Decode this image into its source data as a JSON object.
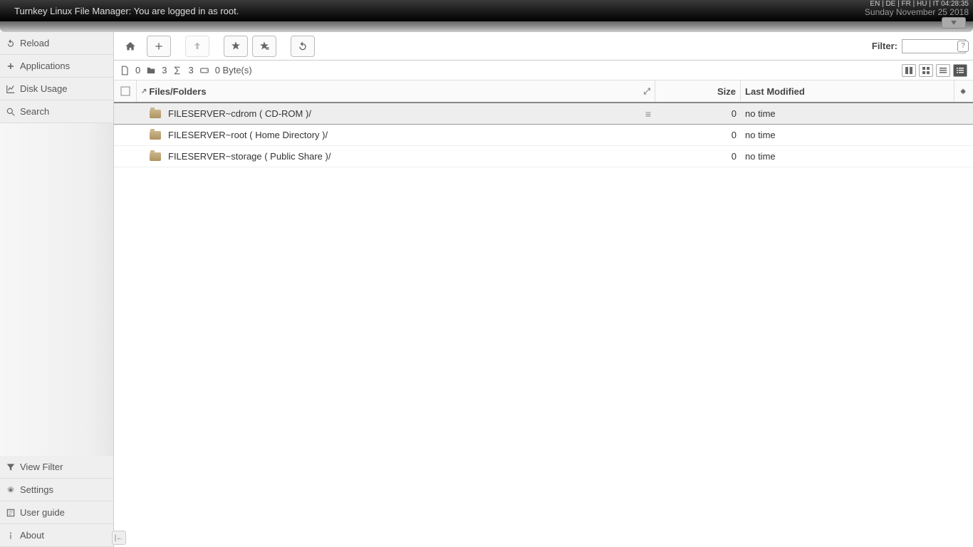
{
  "topbar": {
    "title": "Turnkey Linux File Manager: You are logged in as root.",
    "langs": "EN | DE | FR | HU | IT    04:28:35",
    "date": "Sunday November 25 2018"
  },
  "sidebar": {
    "top": [
      {
        "label": "Reload",
        "icon": "reload-icon"
      },
      {
        "label": "Applications",
        "icon": "apps-icon"
      },
      {
        "label": "Disk Usage",
        "icon": "chart-icon"
      },
      {
        "label": "Search",
        "icon": "search-icon"
      }
    ],
    "bottom": [
      {
        "label": "View Filter",
        "icon": "filter-icon"
      },
      {
        "label": "Settings",
        "icon": "gear-icon"
      },
      {
        "label": "User guide",
        "icon": "book-icon"
      },
      {
        "label": "About",
        "icon": "info-icon"
      }
    ]
  },
  "toolbar": {
    "filter_label": "Filter:",
    "filter_value": "",
    "filter_placeholder": ""
  },
  "status": {
    "files_count": "0",
    "folders_count": "3",
    "total_count": "3",
    "bytes": "0 Byte(s)"
  },
  "columns": {
    "name": "Files/Folders",
    "size": "Size",
    "modified": "Last Modified"
  },
  "rows": [
    {
      "name": "FILESERVER~cdrom ( CD-ROM )/",
      "size": "0",
      "modified": "no time",
      "selected": true
    },
    {
      "name": "FILESERVER~root ( Home Directory )/",
      "size": "0",
      "modified": "no time",
      "selected": false
    },
    {
      "name": "FILESERVER~storage ( Public Share )/",
      "size": "0",
      "modified": "no time",
      "selected": false
    }
  ]
}
